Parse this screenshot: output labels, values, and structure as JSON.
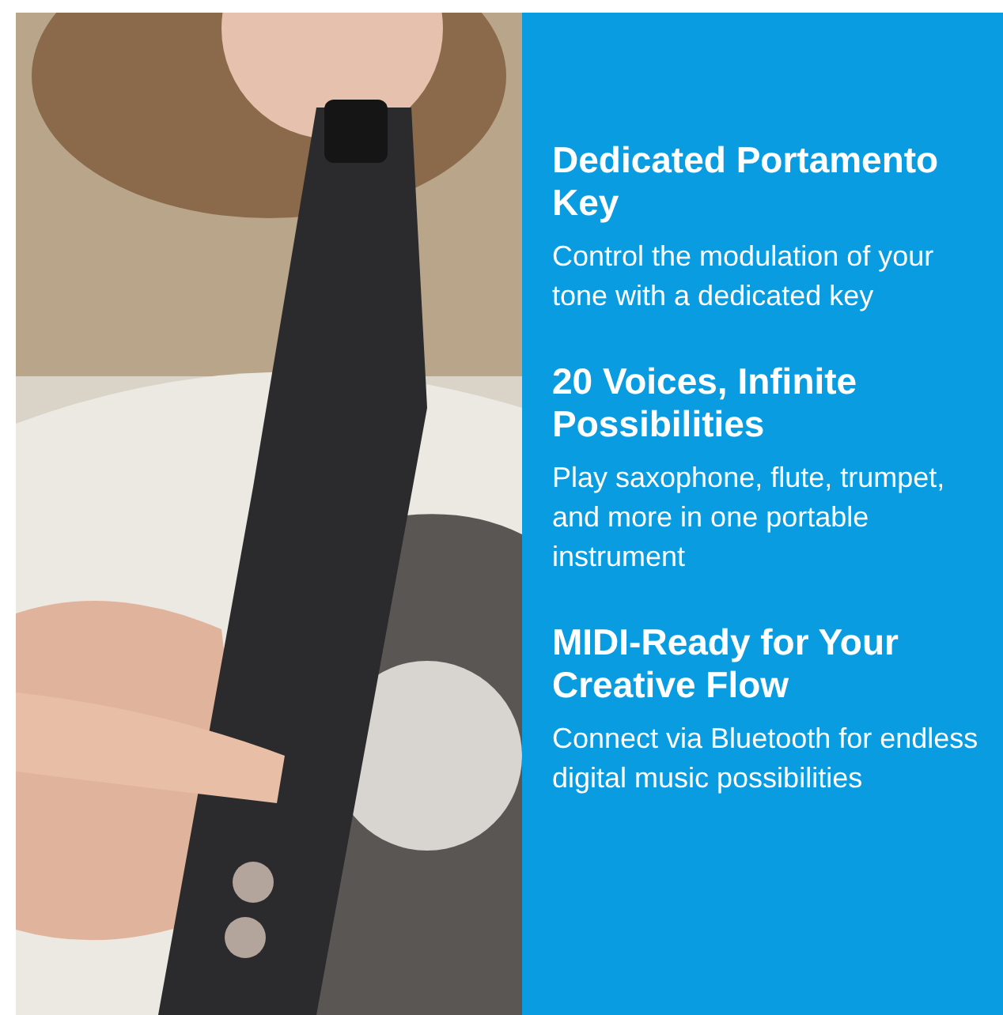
{
  "features": [
    {
      "title": "Dedicated Portamento Key",
      "description": "Control the modulation of your tone with a dedicated key"
    },
    {
      "title": "20 Voices, Infinite Possibilities",
      "description": "Play saxophone, flute, trumpet, and more in one portable instrument"
    },
    {
      "title": "MIDI-Ready for Your Creative Flow",
      "description": "Connect via Bluetooth for endless digital music possibilities"
    }
  ]
}
